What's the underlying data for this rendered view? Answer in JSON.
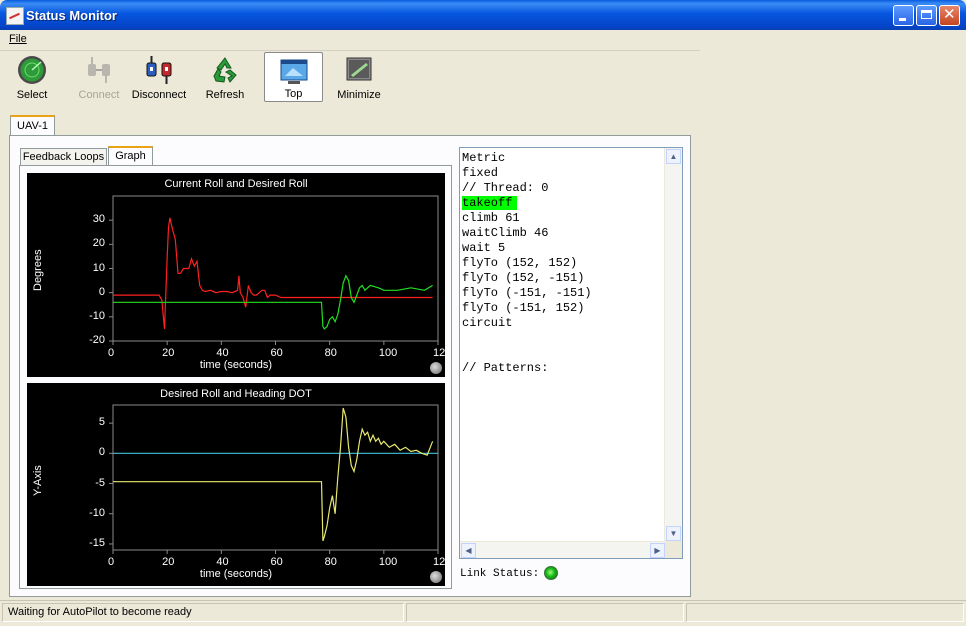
{
  "window": {
    "title": "Status Monitor"
  },
  "menu": {
    "file": "File"
  },
  "toolbar": {
    "select": "Select",
    "connect": "Connect",
    "disconnect": "Disconnect",
    "refresh": "Refresh",
    "top": "Top",
    "minimize": "Minimize"
  },
  "tabs": {
    "uav": "UAV-1",
    "feedback": "Feedback Loops",
    "graph": "Graph"
  },
  "chart_data": [
    {
      "type": "line",
      "title": "Current Roll and Desired Roll",
      "xlabel": "time (seconds)",
      "ylabel": "Degrees",
      "xlim": [
        0,
        120
      ],
      "ylim": [
        -20,
        40
      ],
      "xticks": [
        "0",
        "20",
        "40",
        "60",
        "80",
        "100",
        "12"
      ],
      "yticks": [
        "30",
        "20",
        "10",
        "0",
        "-10",
        "-20"
      ],
      "grid": false,
      "series": [
        {
          "color": "#ff2020",
          "x": [
            0,
            17,
            18,
            19,
            20,
            20.5,
            21,
            22,
            23,
            24,
            25,
            26,
            28,
            29,
            30,
            31,
            32,
            33,
            34,
            36,
            38,
            40,
            42,
            44,
            46,
            46.5,
            47,
            48,
            49,
            50,
            51,
            52,
            53,
            54,
            55,
            56,
            57,
            58,
            60,
            62,
            64,
            66,
            70,
            75,
            80,
            90,
            100,
            110,
            118
          ],
          "y": [
            -1,
            -1,
            -3,
            -15,
            15,
            27,
            31,
            26,
            22,
            8,
            8,
            10,
            10,
            14,
            11,
            13,
            3,
            1,
            0.5,
            1,
            0,
            0.5,
            0.5,
            0,
            1,
            7,
            0,
            -2,
            -6,
            3,
            0,
            -1,
            -1,
            0,
            1,
            1,
            -2,
            -1,
            -1,
            -2,
            -2,
            -2,
            -2,
            -2,
            -2,
            -2,
            -2,
            -2,
            -2
          ]
        },
        {
          "color": "#20e020",
          "x": [
            0,
            10,
            20,
            30,
            40,
            50,
            60,
            70,
            77,
            77.5,
            78,
            79,
            80,
            81,
            82,
            83,
            84,
            85,
            86,
            87,
            88,
            89,
            90,
            91,
            92,
            93,
            95,
            98,
            100,
            105,
            110,
            115,
            118
          ],
          "y": [
            -4,
            -4,
            -4,
            -4,
            -4,
            -4,
            -4,
            -4,
            -4,
            -14,
            -15,
            -14,
            -11,
            -10,
            -12,
            -9,
            -3,
            4,
            7,
            5,
            -2,
            -4,
            -1,
            2,
            3,
            1,
            3,
            2,
            1,
            1,
            2,
            1,
            3
          ]
        }
      ]
    },
    {
      "type": "line",
      "title": "Desired Roll and Heading DOT",
      "xlabel": "time (seconds)",
      "ylabel": "Y-Axis",
      "xlim": [
        0,
        120
      ],
      "ylim": [
        -16,
        8
      ],
      "xticks": [
        "0",
        "20",
        "40",
        "60",
        "80",
        "100",
        "12"
      ],
      "yticks": [
        "5",
        "0",
        "-5",
        "-10",
        "-15"
      ],
      "grid": false,
      "series": [
        {
          "color": "#3fc0d8",
          "x": [
            0,
            120
          ],
          "y": [
            0,
            0
          ]
        },
        {
          "color": "#e8e870",
          "x": [
            0,
            10,
            20,
            30,
            40,
            50,
            60,
            70,
            77,
            77.5,
            78,
            79,
            80,
            81,
            82,
            83,
            84,
            85,
            86,
            87,
            88,
            89,
            90,
            91,
            92,
            93,
            94,
            95,
            96,
            97,
            98,
            99,
            100,
            102,
            104,
            106,
            108,
            110,
            112,
            114,
            116,
            118
          ],
          "y": [
            -4.7,
            -4.7,
            -4.7,
            -4.7,
            -4.7,
            -4.7,
            -4.7,
            -4.7,
            -4.7,
            -14.5,
            -13.8,
            -12,
            -9,
            -7,
            -10,
            -4,
            1,
            7.5,
            6,
            1,
            -2,
            -3,
            -1,
            2,
            4,
            3,
            3.5,
            2,
            3,
            2,
            2.5,
            1.5,
            2,
            1,
            1.5,
            0.5,
            1,
            0.3,
            0.5,
            0,
            -0.3,
            2
          ]
        }
      ]
    }
  ],
  "script": {
    "lines": [
      "Metric",
      "fixed",
      "// Thread: 0",
      "takeoff",
      "climb 61",
      "waitClimb 46",
      "wait 5",
      "flyTo (152, 152)",
      "flyTo (152, -151)",
      "flyTo (-151, -151)",
      "flyTo (-151, 152)",
      "circuit",
      "",
      "",
      "// Patterns:"
    ],
    "highlighted": "takeoff"
  },
  "link": {
    "label": "Link Status:"
  },
  "status": {
    "message": "Waiting for AutoPilot to become ready"
  }
}
